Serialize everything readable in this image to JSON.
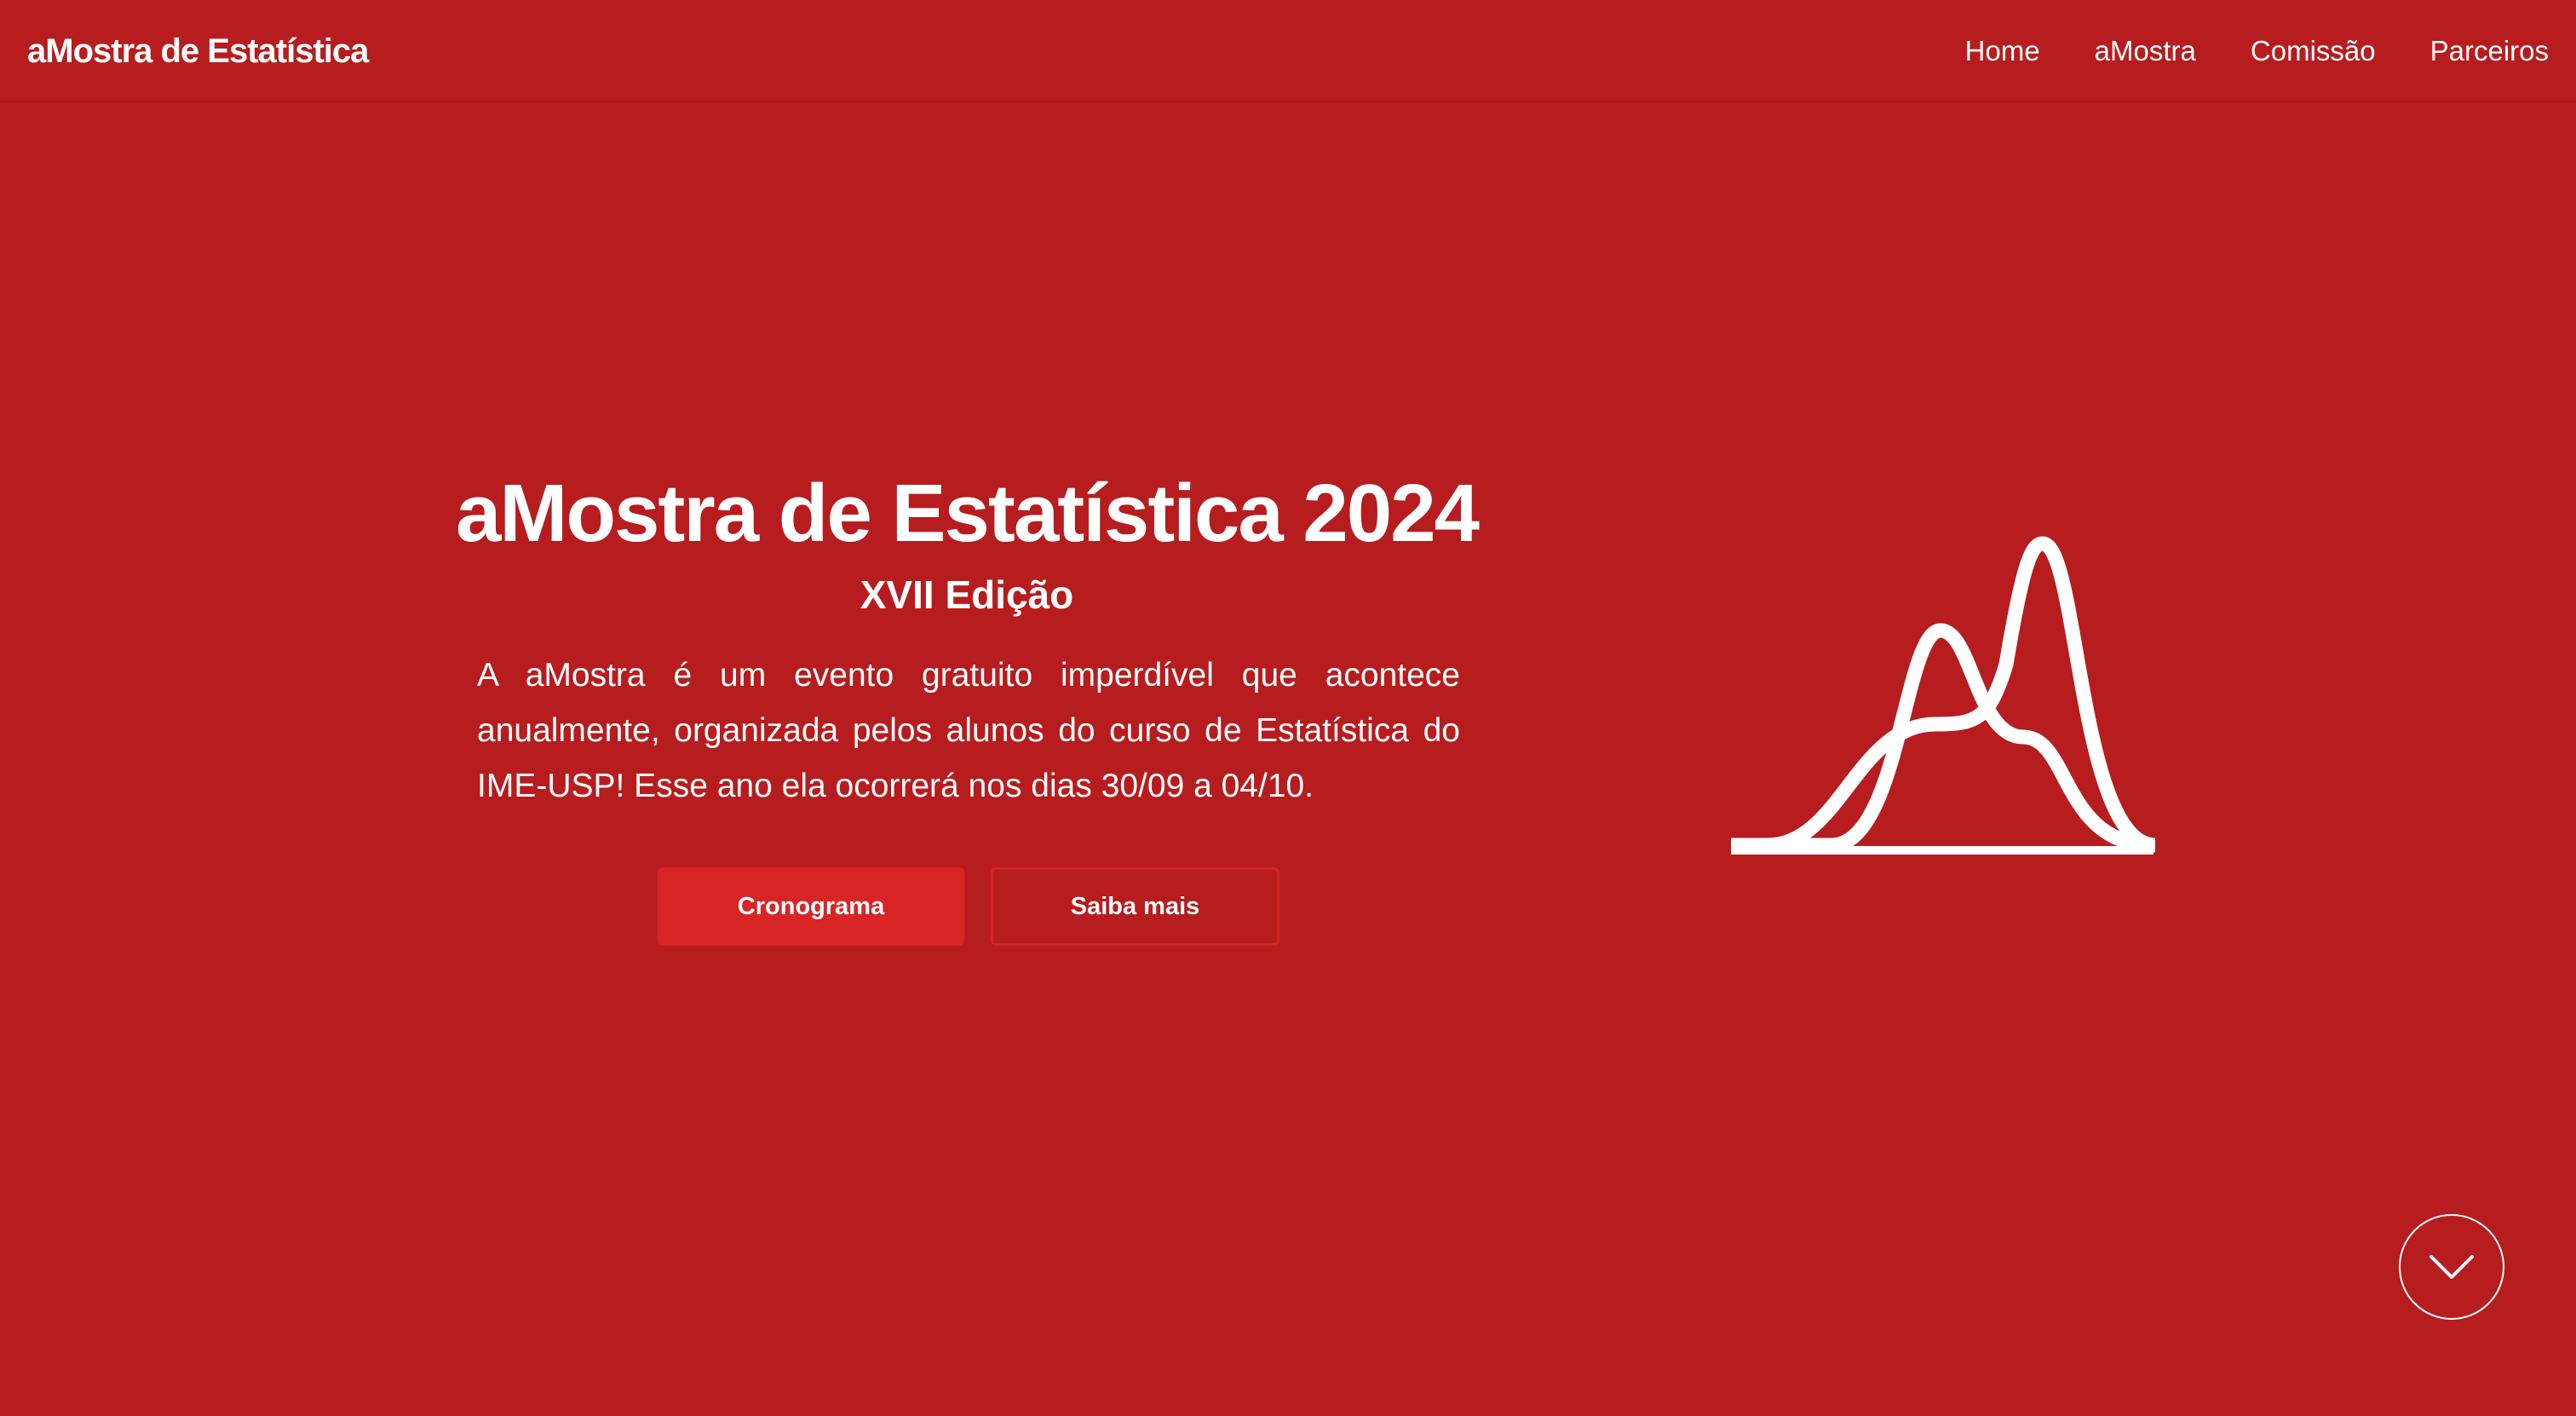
{
  "nav": {
    "brand": "aMostra de Estatística",
    "links": [
      "Home",
      "aMostra",
      "Comissão",
      "Parceiros"
    ]
  },
  "hero": {
    "title": "aMostra de Estatística 2024",
    "subtitle": "XVII Edição",
    "description": "A aMostra é um evento gratuito imperdível que acontece anualmente, organizada pelos alunos do curso de Estatística do IME-USP! Esse ano ela ocorrerá nos dias 30/09 a 04/10.",
    "primary_button": "Cronograma",
    "secondary_button": "Saiba mais"
  },
  "icons": {
    "hero_graphic": "distribution-curves-icon",
    "scroll": "chevron-down-icon"
  },
  "colors": {
    "background": "#b71c1e",
    "primary_button": "#d92426",
    "text": "#ffffff"
  }
}
